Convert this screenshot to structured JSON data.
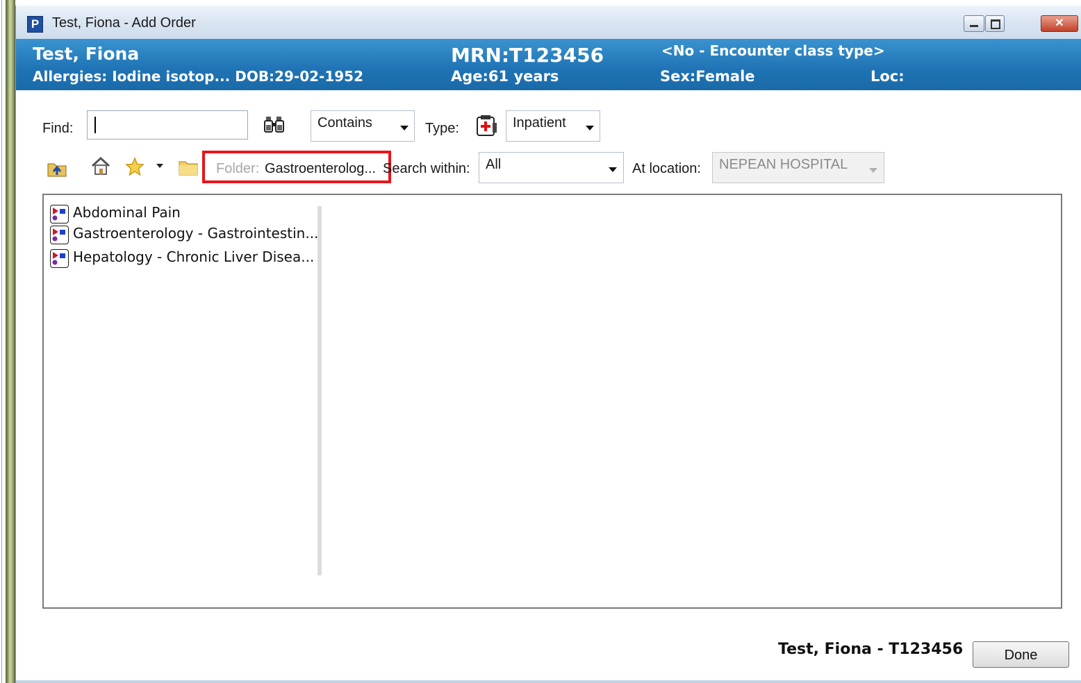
{
  "window": {
    "app_icon": "P",
    "title": "Test, Fiona - Add Order",
    "close_glyph": "✕"
  },
  "banner": {
    "patient_name": "Test, Fiona",
    "allergies": "Allergies:  Iodine isotop... DOB:29-02-1952",
    "mrn": "MRN:T123456",
    "age": "Age:61 years",
    "encounter": "<No - Encounter class type>",
    "sex": "Sex:Female",
    "loc": "Loc:",
    "color": "#1f73b4"
  },
  "search": {
    "find_label": "Find:",
    "find_value": "",
    "match_mode": "Contains",
    "type_label": "Type:",
    "type_value": "Inpatient"
  },
  "toolbar": {
    "icons": [
      "up-folder-icon",
      "home-icon",
      "favorites-star-icon",
      "dropdown-arrow-icon",
      "folder-icon"
    ],
    "folder_label": "Folder:",
    "folder_value": "Gastroenterolog...",
    "search_within_label": "Search within:",
    "search_within_value": "All",
    "at_location_label": "At location:",
    "at_location_value": "NEPEAN HOSPITAL"
  },
  "highlight_color": "#e8141b",
  "orders": [
    {
      "label": "Abdominal Pain",
      "icon": "careset-icon"
    },
    {
      "label": "Gastroenterology - Gastrointestin...",
      "icon": "careset-icon"
    },
    {
      "label": "Hepatology - Chronic Liver Disea...",
      "icon": "careset-icon"
    }
  ],
  "footer": {
    "patient_id": "Test, Fiona - T123456",
    "done_label": "Done"
  }
}
